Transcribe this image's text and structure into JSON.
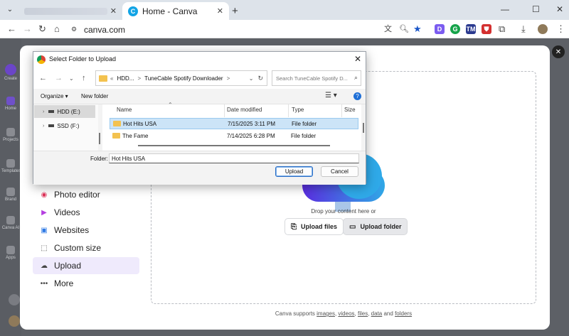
{
  "browser": {
    "active_tab_title": "Home - Canva",
    "url": "canva.com",
    "new_tab_glyph": "+",
    "window_controls": [
      "—",
      "☐",
      "✕"
    ]
  },
  "rail": {
    "items": [
      "Create",
      "Home",
      "Projects",
      "Templates",
      "Brand",
      "Canva AI",
      "Apps"
    ]
  },
  "menu": {
    "items": [
      {
        "label": "Photo editor",
        "icon": "photo-editor-icon",
        "color": "#e0345b"
      },
      {
        "label": "Videos",
        "icon": "video-icon",
        "color": "#b43ee0"
      },
      {
        "label": "Websites",
        "icon": "website-icon",
        "color": "#2f7ae5"
      },
      {
        "label": "Custom size",
        "icon": "custom-size-icon",
        "color": "#444444"
      },
      {
        "label": "Upload",
        "icon": "upload-icon",
        "color": "#444444"
      },
      {
        "label": "More",
        "icon": "more-icon",
        "color": "#444444"
      }
    ],
    "active": "Upload"
  },
  "upload": {
    "drop_text": "Drop your content here or",
    "upload_files_label": "Upload files",
    "upload_folder_label": "Upload folder",
    "supports_prefix": "Canva supports",
    "supports_links": [
      "images",
      "videos",
      "files",
      "data"
    ],
    "supports_and": "and",
    "supports_last": "folders"
  },
  "dialog": {
    "title": "Select Folder to Upload",
    "path": [
      "«",
      "HDD...",
      ">",
      "TuneCable Spotify Downloader",
      ">"
    ],
    "search_placeholder": "Search TuneCable Spotify D...",
    "organize_label": "Organize ▾",
    "new_folder_label": "New folder",
    "tree": [
      {
        "label": "HDD (E:)",
        "selected": true
      },
      {
        "label": "SSD (F:)",
        "selected": false
      }
    ],
    "columns": [
      "Name",
      "Date modified",
      "Type",
      "Size"
    ],
    "rows": [
      {
        "name": "Hot Hits USA",
        "date": "7/15/2025 3:11 PM",
        "type": "File folder",
        "selected": true
      },
      {
        "name": "The Fame",
        "date": "7/14/2025 6:28 PM",
        "type": "File folder",
        "selected": false
      }
    ],
    "folder_label": "Folder:",
    "folder_value": "Hot Hits USA",
    "upload_button": "Upload",
    "cancel_button": "Cancel"
  },
  "colors": {
    "canva_accent": "#8b3dff",
    "selection": "#cce4f7",
    "tab_strip": "#dde3ea"
  }
}
